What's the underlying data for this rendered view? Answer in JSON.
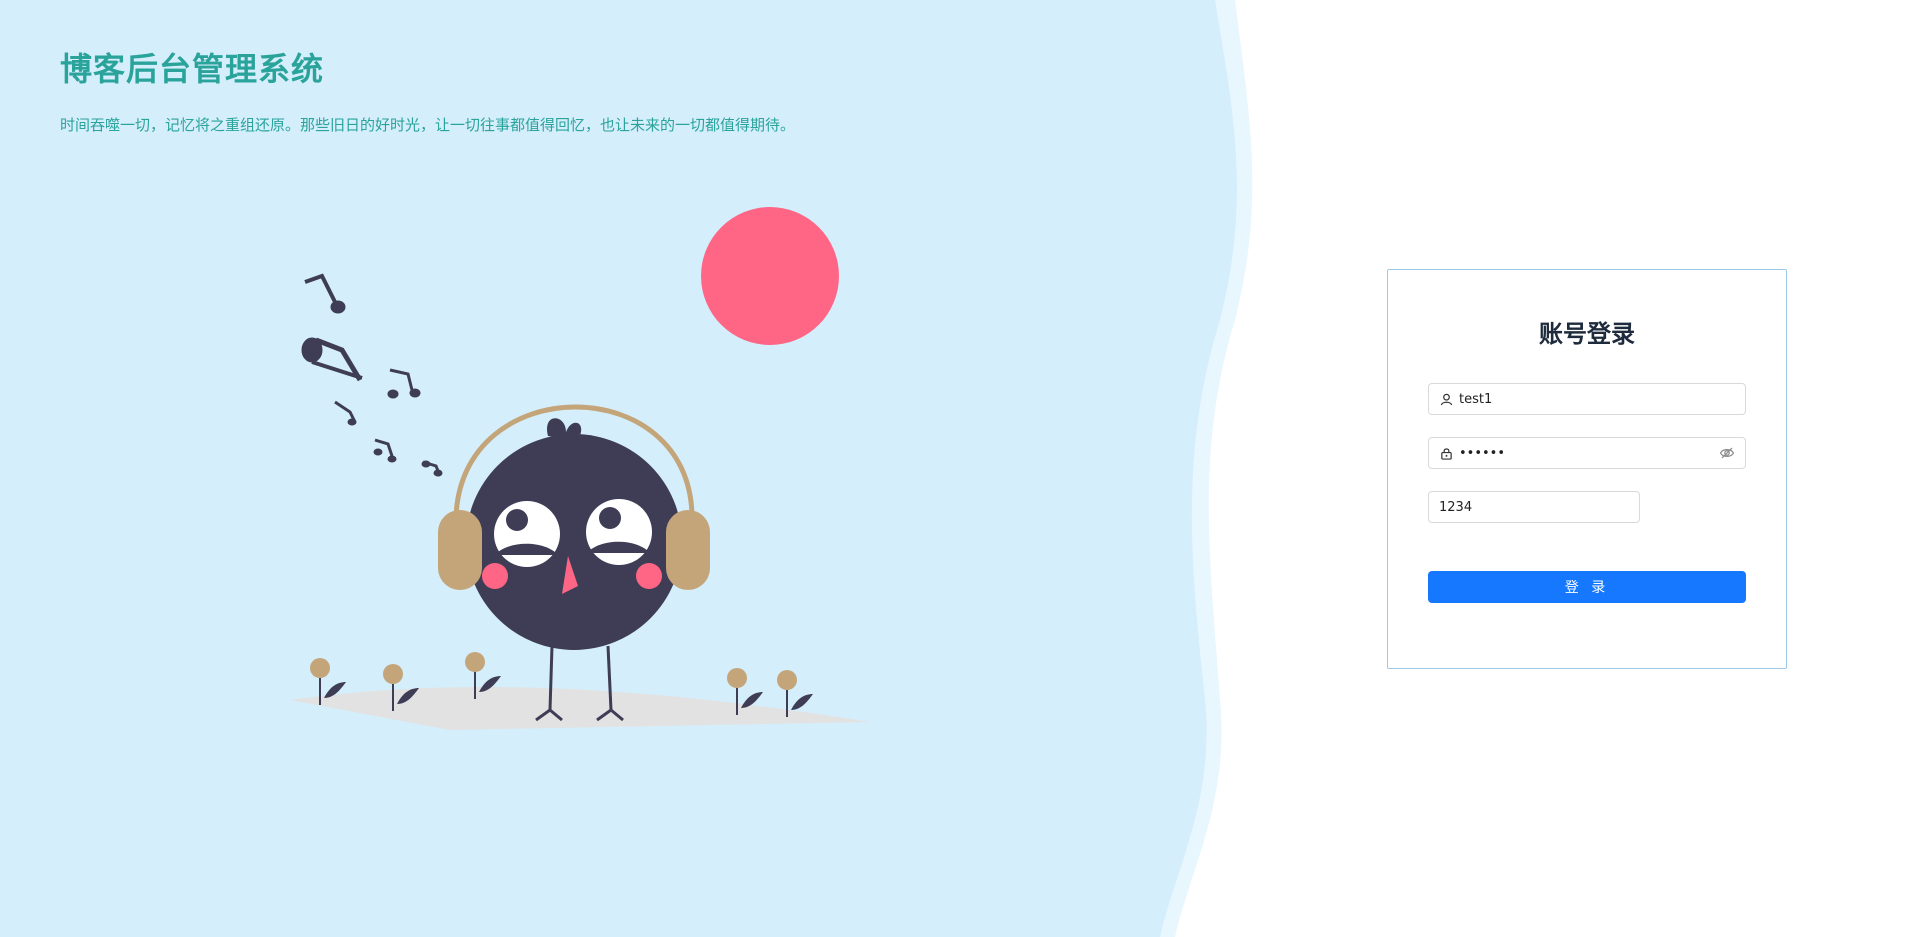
{
  "brand": {
    "title": "博客后台管理系统",
    "subtitle": "时间吞噬一切，记忆将之重组还原。那些旧日的好时光，让一切往事都值得回忆，也让未来的一切都值得期待。"
  },
  "login": {
    "title": "账号登录",
    "username_value": "test1",
    "password_value": "123456",
    "captcha_value": "1234",
    "submit_label": "登 录"
  },
  "colors": {
    "left_bg": "#d4eefc",
    "accent_text": "#2aa39a",
    "primary_button": "#1677ff",
    "sun": "#ff6686",
    "bird_body": "#3f3d56",
    "headphones": "#c4a57a"
  },
  "icons": {
    "user": "user-icon",
    "lock": "lock-icon",
    "eye": "eye-invisible-icon"
  }
}
